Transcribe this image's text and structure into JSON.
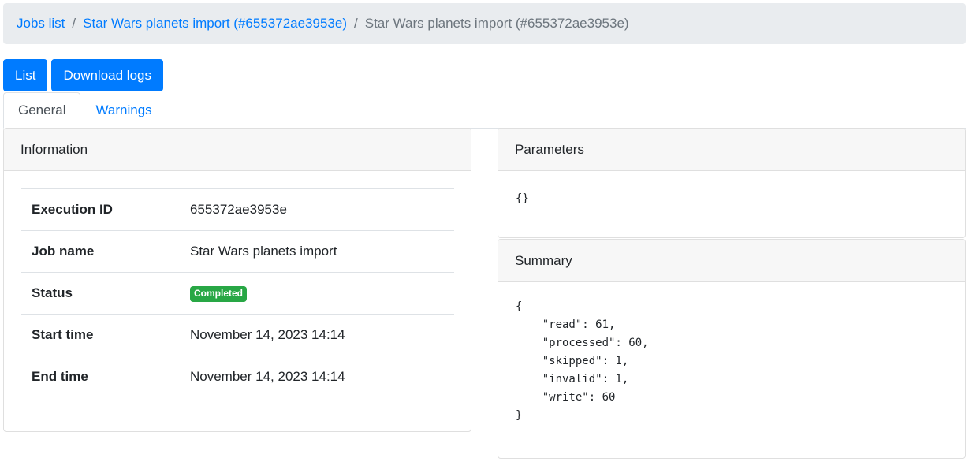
{
  "breadcrumb": {
    "items": [
      "Jobs list",
      "Star Wars planets import (#655372ae3953e)"
    ],
    "current": "Star Wars planets import (#655372ae3953e)",
    "separator": "/"
  },
  "buttons": {
    "list": "List",
    "download_logs": "Download logs"
  },
  "tabs": [
    {
      "label": "General"
    },
    {
      "label": "Warnings"
    }
  ],
  "information": {
    "title": "Information",
    "rows": [
      {
        "label": "Execution ID",
        "value": "655372ae3953e"
      },
      {
        "label": "Job name",
        "value": "Star Wars planets import"
      },
      {
        "label": "Status",
        "value": "Completed"
      },
      {
        "label": "Start time",
        "value": "November 14, 2023 14:14"
      },
      {
        "label": "End time",
        "value": "November 14, 2023 14:14"
      }
    ]
  },
  "parameters": {
    "title": "Parameters",
    "content": "{}"
  },
  "summary": {
    "title": "Summary",
    "content": "{\n    \"read\": 61,\n    \"processed\": 60,\n    \"skipped\": 1,\n    \"invalid\": 1,\n    \"write\": 60\n}"
  },
  "colors": {
    "primary": "#007bff",
    "success": "#28a745",
    "breadcrumb_bg": "#e9ecef",
    "card_header_bg": "#f7f7f7"
  }
}
